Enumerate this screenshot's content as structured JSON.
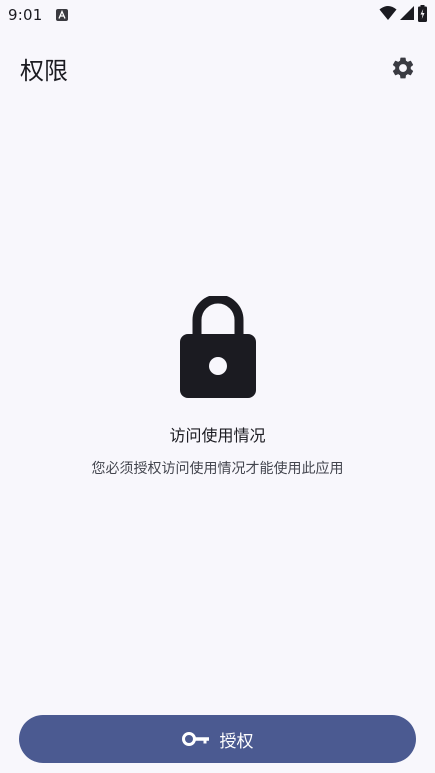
{
  "status_bar": {
    "time": "9:01",
    "notification_icon": "a-letter-badge-icon",
    "icons": [
      "wifi-icon",
      "signal-icon",
      "battery-icon"
    ]
  },
  "app_bar": {
    "title": "权限",
    "settings_icon": "gear-icon"
  },
  "content": {
    "icon": "lock-icon",
    "heading": "访问使用情况",
    "description": "您必须授权访问使用情况才能使用此应用"
  },
  "grant_button": {
    "icon": "key-icon",
    "label": "授权"
  },
  "colors": {
    "background": "#f8f7fc",
    "primary": "#4b5a91",
    "on_primary": "#ffffff",
    "text": "#1b1b21",
    "secondary_text": "#44464f"
  }
}
